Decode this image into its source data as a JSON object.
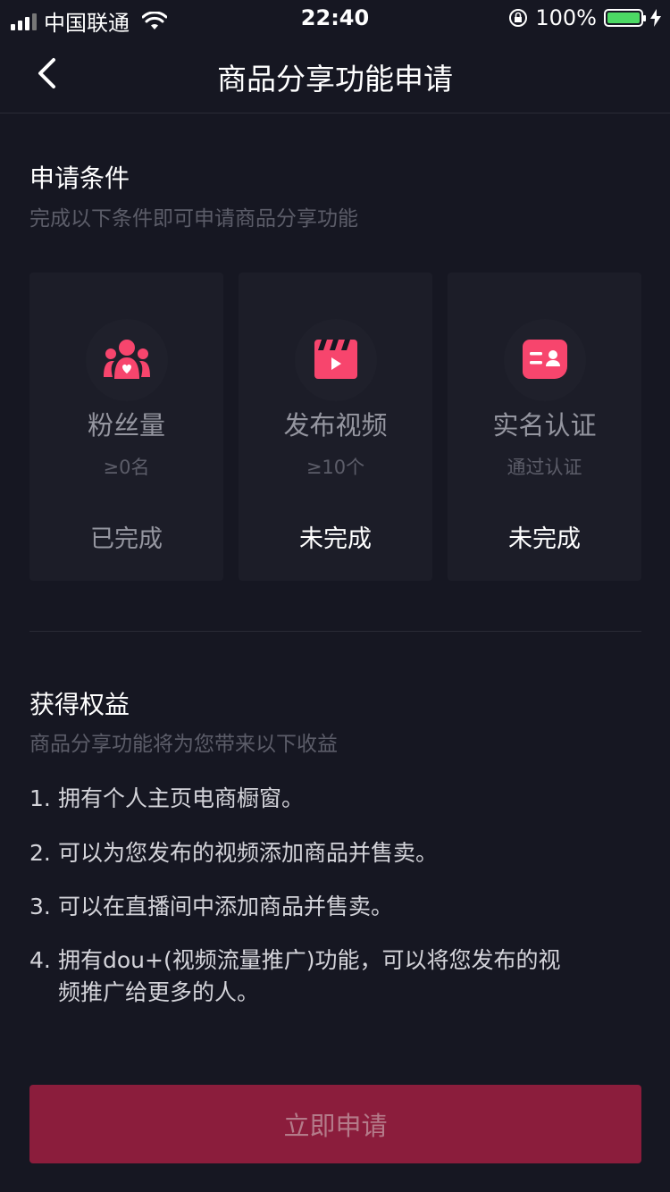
{
  "status_bar": {
    "carrier": "中国联通",
    "time": "22:40",
    "battery": "100%"
  },
  "header": {
    "title": "商品分享功能申请"
  },
  "conditions": {
    "title": "申请条件",
    "subtitle": "完成以下条件即可申请商品分享功能",
    "cards": [
      {
        "icon": "fans-icon",
        "name": "粉丝量",
        "requirement": "≥0名",
        "status": "已完成"
      },
      {
        "icon": "video-icon",
        "name": "发布视频",
        "requirement": "≥10个",
        "status": "未完成"
      },
      {
        "icon": "id-card-icon",
        "name": "实名认证",
        "requirement": "通过认证",
        "status": "未完成"
      }
    ]
  },
  "benefits": {
    "title": "获得权益",
    "subtitle": "商品分享功能将为您带来以下收益",
    "items": [
      {
        "num": "1.",
        "text": "拥有个人主页电商橱窗。"
      },
      {
        "num": "2.",
        "text": "可以为您发布的视频添加商品并售卖。"
      },
      {
        "num": "3.",
        "text": "可以在直播间中添加商品并售卖。"
      },
      {
        "num": "4.",
        "line1": "拥有dou+(视频流量推广)功能，可以将您发布的视",
        "line2": "频推广给更多的人。"
      }
    ]
  },
  "apply_button": "立即申请",
  "colors": {
    "background": "#161722",
    "card": "#1c1d28",
    "accent": "#fe2c55",
    "button": "#8b1d3c"
  }
}
